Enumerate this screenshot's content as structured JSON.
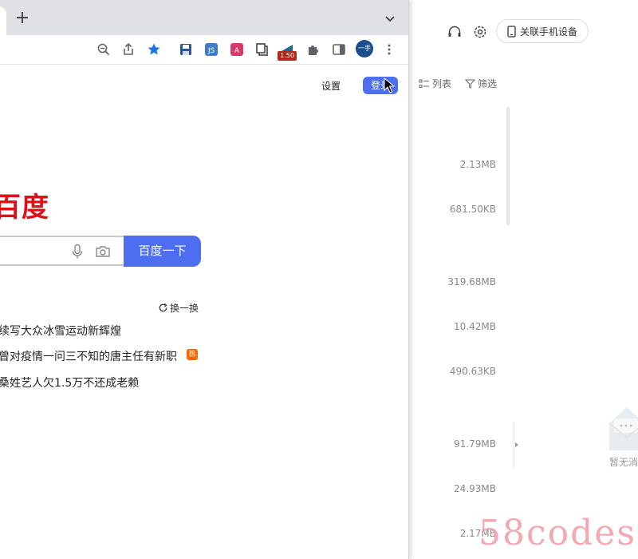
{
  "browser": {
    "new_tab_label": "+",
    "extension_badge": "1.50",
    "profile_label": "一手",
    "page": {
      "settings_label": "设置",
      "login_label": "登录",
      "logo_text": "百度",
      "search_button": "百度一下",
      "refresh_label": "换一换",
      "hot_list": [
        "续写大众冰雪运动新辉煌",
        "曾对疫情一问三不知的唐主任有新职",
        "桑姓艺人欠1.5万不还成老赖"
      ],
      "hot_badge": "热"
    }
  },
  "app": {
    "link_phone_label": "关联手机设备",
    "list_view_label": "列表",
    "filter_label": "筛选",
    "file_sizes": [
      "2.13MB",
      "681.50KB",
      "319.68MB",
      "10.42MB",
      "490.63KB",
      "91.79MB",
      "24.93MB",
      "2.17MB"
    ],
    "empty_text": "暂无消"
  },
  "watermark": "58codes",
  "colors": {
    "accent": "#4e6ef2",
    "baidu_red": "#de0f17",
    "hot": "#ff6600"
  }
}
